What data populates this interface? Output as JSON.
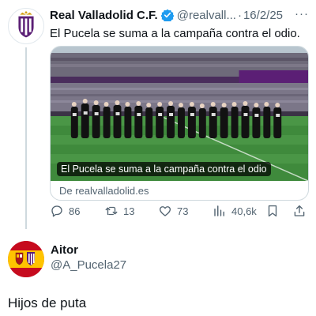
{
  "tweet": {
    "author_name": "Real Valladolid C.F.",
    "author_handle": "@realvall...",
    "separator": "·",
    "date": "16/2/25",
    "more": "···",
    "text": "El Pucela se suma a la campaña contra el odio.",
    "card": {
      "caption": "El Pucela se suma a la campaña contra el odio",
      "source": "De realvalladolid.es"
    },
    "actions": {
      "replies": "86",
      "retweets": "13",
      "likes": "73",
      "views": "40,6k"
    }
  },
  "reply": {
    "author_name": "Aitor",
    "author_handle": "@A_Pucela27",
    "text": "Hijos de puta"
  },
  "icons": {
    "verified": "verified-badge-icon",
    "reply": "reply-icon",
    "retweet": "retweet-icon",
    "like": "heart-icon",
    "views": "views-icon",
    "bookmark": "bookmark-icon",
    "share": "share-icon"
  },
  "colors": {
    "text_primary": "#0f1419",
    "text_secondary": "#536471",
    "verified_blue": "#1d9bf0",
    "thread_line": "#cfd9de",
    "club_purple": "#5b1f75"
  }
}
